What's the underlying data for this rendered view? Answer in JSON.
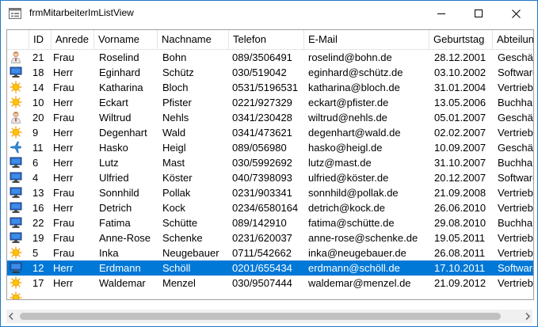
{
  "window": {
    "title": "frmMitarbeiterImListView"
  },
  "columns": [
    "",
    "ID",
    "Anrede",
    "Vorname",
    "Nachname",
    "Telefon",
    "E-Mail",
    "Geburtstag",
    "Abteilung"
  ],
  "rows": [
    {
      "icon": "person-icon",
      "id": "21",
      "anrede": "Frau",
      "vorname": "Roselind",
      "nachname": "Bohn",
      "telefon": "089/3506491",
      "email": "roselind@bohn.de",
      "geburtstag": "28.12.2001",
      "abteilung": "Geschäftsführung"
    },
    {
      "icon": "computer-icon",
      "id": "18",
      "anrede": "Herr",
      "vorname": "Eginhard",
      "nachname": "Schütz",
      "telefon": "030/519042",
      "email": "eginhard@schütz.de",
      "geburtstag": "03.10.2002",
      "abteilung": "Softwareentwicklung"
    },
    {
      "icon": "sun-icon",
      "id": "14",
      "anrede": "Frau",
      "vorname": "Katharina",
      "nachname": "Bloch",
      "telefon": "0531/5196531",
      "email": "katharina@bloch.de",
      "geburtstag": "31.01.2004",
      "abteilung": "Vertrieb"
    },
    {
      "icon": "sun-icon",
      "id": "10",
      "anrede": "Herr",
      "vorname": "Eckart",
      "nachname": "Pfister",
      "telefon": "0221/927329",
      "email": "eckart@pfister.de",
      "geburtstag": "13.05.2006",
      "abteilung": "Buchhaltung"
    },
    {
      "icon": "person-icon",
      "id": "20",
      "anrede": "Frau",
      "vorname": "Wiltrud",
      "nachname": "Nehls",
      "telefon": "0341/230428",
      "email": "wiltrud@nehls.de",
      "geburtstag": "05.01.2007",
      "abteilung": "Geschäftsführung"
    },
    {
      "icon": "sun-icon",
      "id": "9",
      "anrede": "Herr",
      "vorname": "Degenhart",
      "nachname": "Wald",
      "telefon": "0341/473621",
      "email": "degenhart@wald.de",
      "geburtstag": "02.02.2007",
      "abteilung": "Vertrieb"
    },
    {
      "icon": "plane-icon",
      "id": "11",
      "anrede": "Herr",
      "vorname": "Hasko",
      "nachname": "Heigl",
      "telefon": "089/056980",
      "email": "hasko@heigl.de",
      "geburtstag": "10.09.2007",
      "abteilung": "Geschäftsführung"
    },
    {
      "icon": "computer-icon",
      "id": "6",
      "anrede": "Herr",
      "vorname": "Lutz",
      "nachname": "Mast",
      "telefon": "030/5992692",
      "email": "lutz@mast.de",
      "geburtstag": "31.10.2007",
      "abteilung": "Buchhaltung"
    },
    {
      "icon": "computer-icon",
      "id": "4",
      "anrede": "Herr",
      "vorname": "Ulfried",
      "nachname": "Köster",
      "telefon": "040/7398093",
      "email": "ulfried@köster.de",
      "geburtstag": "20.12.2007",
      "abteilung": "Softwareentwicklung"
    },
    {
      "icon": "computer-icon",
      "id": "13",
      "anrede": "Frau",
      "vorname": "Sonnhild",
      "nachname": "Pollak",
      "telefon": "0231/903341",
      "email": "sonnhild@pollak.de",
      "geburtstag": "21.09.2008",
      "abteilung": "Vertrieb"
    },
    {
      "icon": "computer-icon",
      "id": "16",
      "anrede": "Herr",
      "vorname": "Detrich",
      "nachname": "Kock",
      "telefon": "0234/6580164",
      "email": "detrich@kock.de",
      "geburtstag": "26.06.2010",
      "abteilung": "Vertrieb"
    },
    {
      "icon": "computer-icon",
      "id": "22",
      "anrede": "Frau",
      "vorname": "Fatima",
      "nachname": "Schütte",
      "telefon": "089/142910",
      "email": "fatima@schütte.de",
      "geburtstag": "29.08.2010",
      "abteilung": "Buchhaltung"
    },
    {
      "icon": "computer-icon",
      "id": "19",
      "anrede": "Frau",
      "vorname": "Anne-Rose",
      "nachname": "Schenke",
      "telefon": "0231/620037",
      "email": "anne-rose@schenke.de",
      "geburtstag": "19.05.2011",
      "abteilung": "Vertrieb"
    },
    {
      "icon": "sun-icon",
      "id": "5",
      "anrede": "Frau",
      "vorname": "Inka",
      "nachname": "Neugebauer",
      "telefon": "0711/542662",
      "email": "inka@neugebauer.de",
      "geburtstag": "26.08.2011",
      "abteilung": "Vertrieb"
    },
    {
      "icon": "computer-icon",
      "id": "12",
      "anrede": "Herr",
      "vorname": "Erdmann",
      "nachname": "Schöll",
      "telefon": "0201/655434",
      "email": "erdmann@schöll.de",
      "geburtstag": "17.10.2011",
      "abteilung": "Softwareentwicklung",
      "selected": true
    },
    {
      "icon": "sun-icon",
      "id": "17",
      "anrede": "Herr",
      "vorname": "Waldemar",
      "nachname": "Menzel",
      "telefon": "030/9507444",
      "email": "waldemar@menzel.de",
      "geburtstag": "21.09.2012",
      "abteilung": "Vertrieb"
    },
    {
      "icon": "sun-icon",
      "id": "",
      "anrede": "",
      "vorname": "",
      "nachname": "",
      "telefon": "",
      "email": "",
      "geburtstag": "",
      "abteilung": ""
    }
  ],
  "colors": {
    "selection": "#0078d7",
    "window_border": "#1e78c8"
  }
}
